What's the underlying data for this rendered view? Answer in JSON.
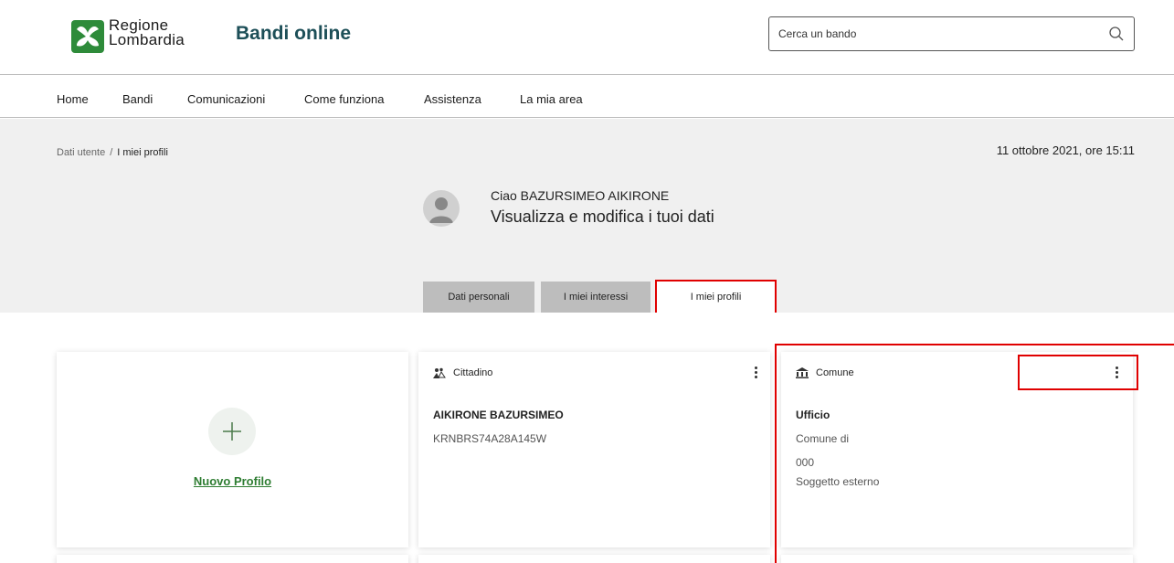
{
  "header": {
    "logo_line1": "Regione",
    "logo_line2": "Lombardia",
    "app_title": "Bandi online",
    "search_placeholder": "Cerca un bando"
  },
  "nav": {
    "items": [
      {
        "label": "Home"
      },
      {
        "label": "Bandi"
      },
      {
        "label": "Comunicazioni"
      },
      {
        "label": "Come funziona"
      },
      {
        "label": "Assistenza"
      },
      {
        "label": "La mia area"
      }
    ]
  },
  "breadcrumb": {
    "parent": "Dati utente",
    "separator": "/",
    "current": "I miei profili"
  },
  "date": "11 ottobre 2021, ore 15:11",
  "user": {
    "greeting": "Ciao BAZURSIMEO AIKIRONE",
    "subtitle": "Visualizza e modifica i tuoi dati"
  },
  "tabs": [
    {
      "label": "Dati personali"
    },
    {
      "label": "I miei interessi"
    },
    {
      "label": "I miei profili"
    }
  ],
  "cards": {
    "new_profile": {
      "label": "Nuovo Profilo"
    },
    "cittadino": {
      "type": "Cittadino",
      "name": "AIKIRONE BAZURSIMEO",
      "code": "KRNBRS74A28A145W"
    },
    "comune": {
      "type": "Comune",
      "line1": "Ufficio",
      "line2": "Comune di",
      "line3": "000",
      "line4": "Soggetto esterno"
    }
  },
  "colors": {
    "brand_green": "#2e8b3a",
    "title_teal": "#1d4f58",
    "highlight_red": "#e00000",
    "link_green": "#2e7d32"
  }
}
